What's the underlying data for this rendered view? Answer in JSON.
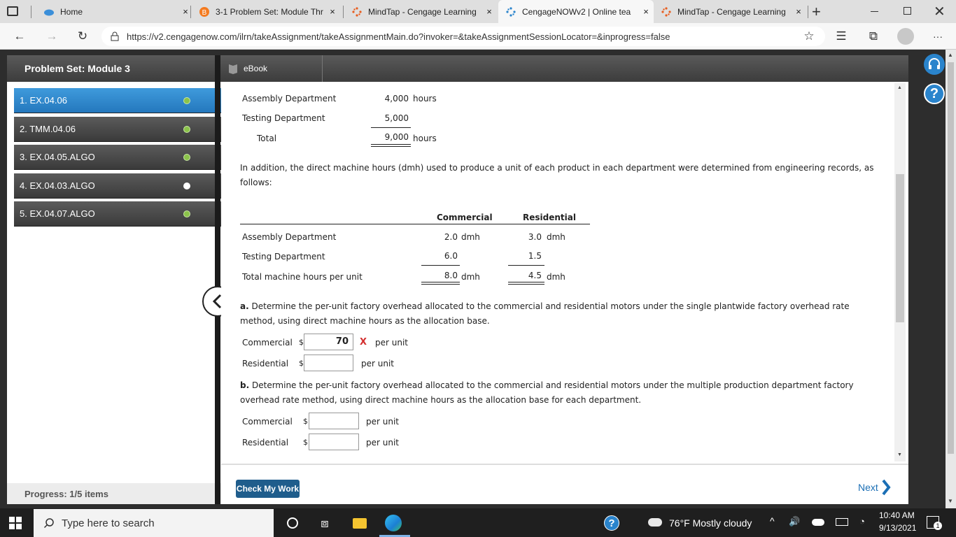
{
  "browser": {
    "tabs": [
      {
        "label": "Home",
        "close": "×"
      },
      {
        "label": "3-1 Problem Set: Module Thr",
        "close": "×"
      },
      {
        "label": "MindTap - Cengage Learning",
        "close": "×"
      },
      {
        "label": "CengageNOWv2 | Online tea",
        "close": "×"
      },
      {
        "label": "MindTap - Cengage Learning",
        "close": "×"
      }
    ],
    "new_tab": "+",
    "url": "https://v2.cengagenow.com/ilrn/takeAssignment/takeAssignmentMain.do?invoker=&takeAssignmentSessionLocator=&inprogress=false",
    "more": "···"
  },
  "sidebar": {
    "title": "Problem Set: Module 3",
    "items": [
      {
        "label": "1. EX.04.06",
        "status": "green"
      },
      {
        "label": "2. TMM.04.06",
        "status": "green"
      },
      {
        "label": "3. EX.04.05.ALGO",
        "status": "green"
      },
      {
        "label": "4. EX.04.03.ALGO",
        "status": "white"
      },
      {
        "label": "5. EX.04.07.ALGO",
        "status": "green"
      }
    ],
    "progress": "Progress:  1/5 items"
  },
  "toolbar": {
    "ebook": "eBook"
  },
  "content": {
    "hours_table": {
      "rows": [
        {
          "label": "Assembly Department",
          "value": "4,000",
          "unit": "hours"
        },
        {
          "label": "Testing Department",
          "value": "5,000",
          "unit": ""
        },
        {
          "label": "Total",
          "value": "9,000",
          "unit": "hours"
        }
      ]
    },
    "intro_line1": "In addition, the direct machine hours (dmh) used to produce a unit of each product in each department were determined from engineering records, as",
    "intro_line2": "follows:",
    "dmh_table": {
      "headers": [
        "Commercial",
        "Residential"
      ],
      "rows": [
        {
          "label": "Assembly Department",
          "commercial": "2.0",
          "commercial_unit": "dmh",
          "residential": "3.0",
          "residential_unit": "dmh"
        },
        {
          "label": "Testing Department",
          "commercial": "6.0",
          "commercial_unit": "",
          "residential": "1.5",
          "residential_unit": ""
        },
        {
          "label": "Total machine hours per unit",
          "commercial": "8.0",
          "commercial_unit": "dmh",
          "residential": "4.5",
          "residential_unit": "dmh"
        }
      ]
    },
    "part_a": {
      "letter": "a.",
      "line1": "Determine the per-unit factory overhead allocated to the commercial and residential motors under the single plantwide factory overhead rate",
      "line2": "method, using direct machine hours as the allocation base.",
      "commercial_label": "Commercial",
      "commercial_value": "70",
      "commercial_mark": "X",
      "residential_label": "Residential",
      "residential_value": "",
      "currency": "$",
      "per_unit": "per unit"
    },
    "part_b": {
      "letter": "b.",
      "line1": "Determine the per-unit factory overhead allocated to the commercial and residential motors under the multiple production department factory",
      "line2": "overhead rate method, using direct machine hours as the allocation base for each department.",
      "commercial_label": "Commercial",
      "commercial_value": "",
      "residential_label": "Residential",
      "residential_value": "",
      "currency": "$",
      "per_unit": "per unit"
    }
  },
  "footer": {
    "check_my_work": "Check My Work",
    "next": "Next"
  },
  "taskbar": {
    "search_placeholder": "Type here to search",
    "weather": "76°F  Mostly cloudy",
    "time": "10:40 AM",
    "date": "9/13/2021",
    "notifications": "1"
  },
  "colors": {
    "accent_blue": "#2a84cc",
    "status_green": "#8bc34a",
    "error_red": "#d32f2f",
    "button_blue": "#1f5d8c",
    "link_blue": "#1b6fb5"
  }
}
